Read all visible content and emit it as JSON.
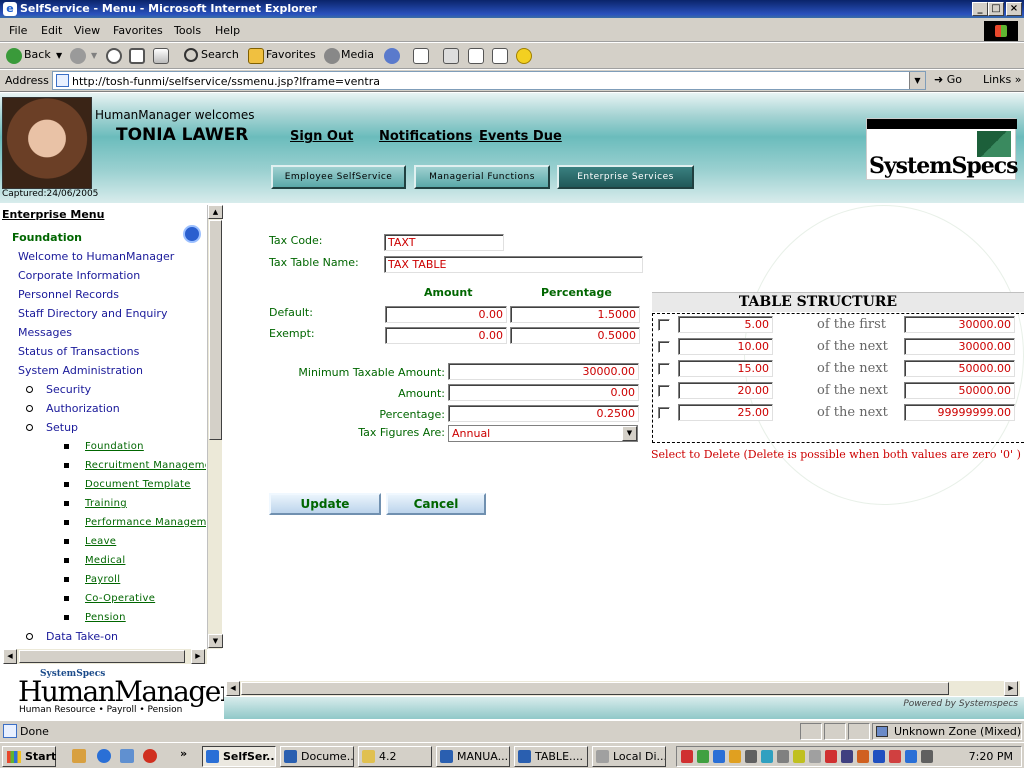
{
  "window": {
    "title": "SelfService - Menu - Microsoft Internet Explorer",
    "controls": [
      "_",
      "□",
      "×"
    ]
  },
  "menubar": [
    "File",
    "Edit",
    "View",
    "Favorites",
    "Tools",
    "Help"
  ],
  "toolbar": {
    "back": "Back",
    "search": "Search",
    "favorites": "Favorites",
    "media": "Media"
  },
  "address": {
    "label": "Address",
    "url": "http://tosh-funmi/selfservice/ssmenu.jsp?lframe=ventra",
    "go": "Go",
    "links": "Links"
  },
  "header": {
    "captured": "Captured:24/06/2005",
    "welcome": "HumanManager welcomes",
    "username": "TONIA LAWER",
    "links": [
      "Sign Out",
      "Notifications",
      "Events Due"
    ],
    "tabs": [
      "Employee SelfService",
      "Managerial Functions",
      "Enterprise Services"
    ],
    "active_tab": "Enterprise Services",
    "logo_text": "SystemSpecs"
  },
  "sidebar": {
    "title": "Enterprise Menu",
    "root": "Foundation",
    "items": [
      "Welcome to HumanManager",
      "Corporate Information",
      "Personnel Records",
      "Staff Directory and Enquiry",
      "Messages",
      "Status of Transactions",
      "System Administration"
    ],
    "admin_children": [
      "Security",
      "Authorization",
      "Setup"
    ],
    "setup_children": [
      "Foundation",
      "Recruitment Management",
      "Document Template",
      "Training",
      "Performance Management",
      "Leave",
      "Medical",
      "Payroll",
      "Co-Operative",
      "Pension"
    ],
    "last_item": "Data Take-on",
    "brand_small": "SystemSpecs",
    "brand_big": "HumanManager",
    "brand_sub": "Human Resource • Payroll • Pension"
  },
  "form": {
    "tax_code_label": "Tax Code:",
    "tax_code": "TAXT",
    "tax_table_name_label": "Tax Table Name:",
    "tax_table_name": "TAX TABLE",
    "col_amount": "Amount",
    "col_percentage": "Percentage",
    "default_label": "Default:",
    "default_amount": "0.00",
    "default_percentage": "1.5000",
    "exempt_label": "Exempt:",
    "exempt_amount": "0.00",
    "exempt_percentage": "0.5000",
    "min_taxable_label": "Minimum Taxable Amount:",
    "min_taxable": "30000.00",
    "amount_label": "Amount:",
    "amount": "0.00",
    "percentage_label": "Percentage:",
    "percentage": "0.2500",
    "tax_figures_label": "Tax Figures Are:",
    "tax_figures": "Annual",
    "update": "Update",
    "cancel": "Cancel"
  },
  "table_structure": {
    "title": "TABLE STRUCTURE",
    "rows": [
      {
        "rate": "5.00",
        "phrase": "of the first",
        "limit": "30000.00"
      },
      {
        "rate": "10.00",
        "phrase": "of the next",
        "limit": "30000.00"
      },
      {
        "rate": "15.00",
        "phrase": "of the next",
        "limit": "50000.00"
      },
      {
        "rate": "20.00",
        "phrase": "of the next",
        "limit": "50000.00"
      },
      {
        "rate": "25.00",
        "phrase": "of the next",
        "limit": "99999999.00"
      }
    ],
    "note": "Select to Delete (Delete is possible when both values are zero '0' )"
  },
  "footer": {
    "powered": "Powered by Systemspecs"
  },
  "status": {
    "text": "Done",
    "zone": "Unknown Zone (Mixed)"
  },
  "taskbar": {
    "start": "Start",
    "tasks": [
      "SelfSer...",
      "Docume...",
      "4.2",
      "MANUA...",
      "TABLE....",
      "Local Di..."
    ],
    "clock": "7:20 PM"
  },
  "colors": {
    "label_green": "#006600",
    "value_red": "#cc0000",
    "link_blue": "#1a1a9a",
    "header_teal": "#6bbcbc"
  }
}
